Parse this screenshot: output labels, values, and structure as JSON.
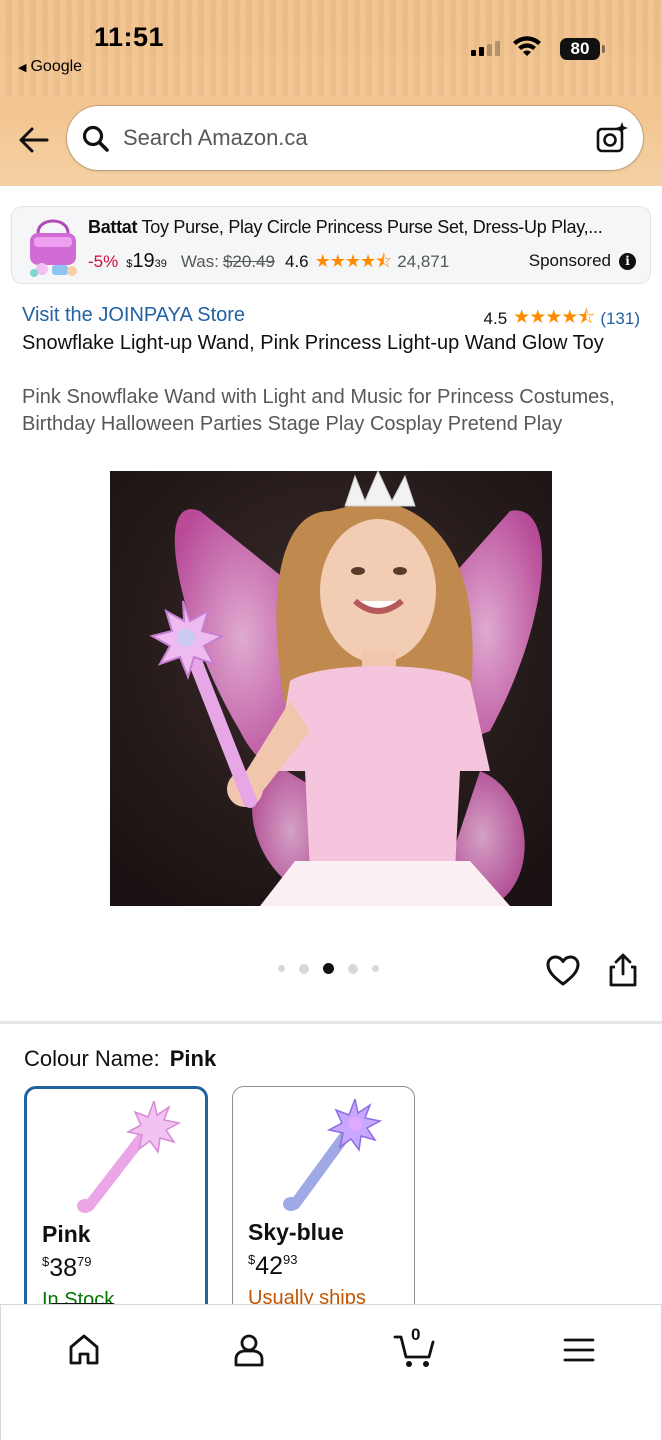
{
  "status_bar": {
    "time": "11:51",
    "back_app": "Google",
    "battery": "80"
  },
  "search": {
    "placeholder": "Search Amazon.ca"
  },
  "sponsored_ad": {
    "brand": "Battat",
    "title": " Toy Purse, Play Circle Princess Purse Set, Dress-Up Play,...",
    "discount": "-5%",
    "price_symbol": "$",
    "price_whole": "19",
    "price_fraction": "39",
    "was_label": "Was:",
    "was_price": "$20.49",
    "rating": "4.6",
    "stars": "★★★★⯪",
    "review_count": "24,871",
    "sponsored_label": "Sponsored"
  },
  "product": {
    "store_link": "Visit the JOINPAYA Store",
    "rating": "4.5",
    "stars": "★★★★⯪",
    "review_count": "(131)",
    "title": "Snowflake Light-up Wand, Pink Princess Light-up Wand Glow Toy",
    "subtitle": "Pink Snowflake Wand with Light and Music for Princess Costumes, Birthday Halloween Parties Stage Play Cosplay Pretend Play",
    "image_count": 5,
    "current_image_index": 3
  },
  "variations": {
    "label": "Colour Name:",
    "selected": "Pink",
    "options": [
      {
        "name": "Pink",
        "price_symbol": "$",
        "price_whole": "38",
        "price_fraction": "79",
        "availability": "In Stock"
      },
      {
        "name": "Sky-blue",
        "price_symbol": "$",
        "price_whole": "42",
        "price_fraction": "93",
        "availability": "Usually ships"
      }
    ]
  },
  "bottom_nav": {
    "cart_count": "0"
  },
  "colors": {
    "header": "#f0c089",
    "link": "#2162a1",
    "star": "#ff8c00",
    "discount": "#cc0c39",
    "in_stock": "#007600",
    "ships": "#c45500"
  }
}
